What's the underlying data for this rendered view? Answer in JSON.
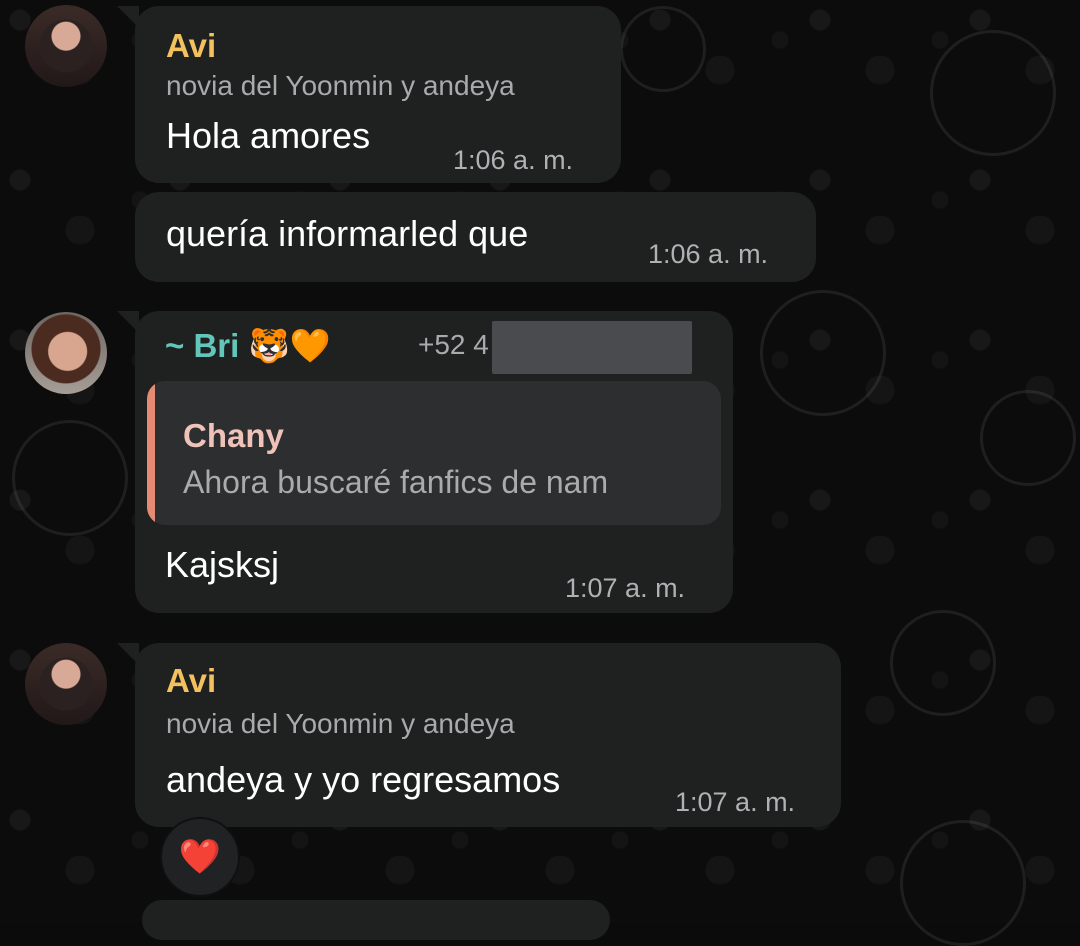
{
  "messages": [
    {
      "sender": "Avi",
      "subtitle": "novia del Yoonmin y andeya",
      "text": "Hola amores",
      "time": "1:06 a. m.",
      "sender_color": "#f3c15d"
    },
    {
      "text": "quería informarled que",
      "time": "1:06 a. m."
    },
    {
      "sender": "~ Bri 🐯🧡",
      "phone_prefix": "+52 4",
      "text": "Kajsksj",
      "time": "1:07 a. m.",
      "sender_color": "#62c7ba",
      "reply": {
        "author": "Chany",
        "text": "Ahora buscaré fanfics de nam"
      }
    },
    {
      "sender": "Avi",
      "subtitle": "novia del Yoonmin y andeya",
      "text": "andeya y yo regresamos",
      "time": "1:07 a. m.",
      "sender_color": "#f3c15d"
    }
  ],
  "reaction": {
    "emoji": "❤️"
  }
}
